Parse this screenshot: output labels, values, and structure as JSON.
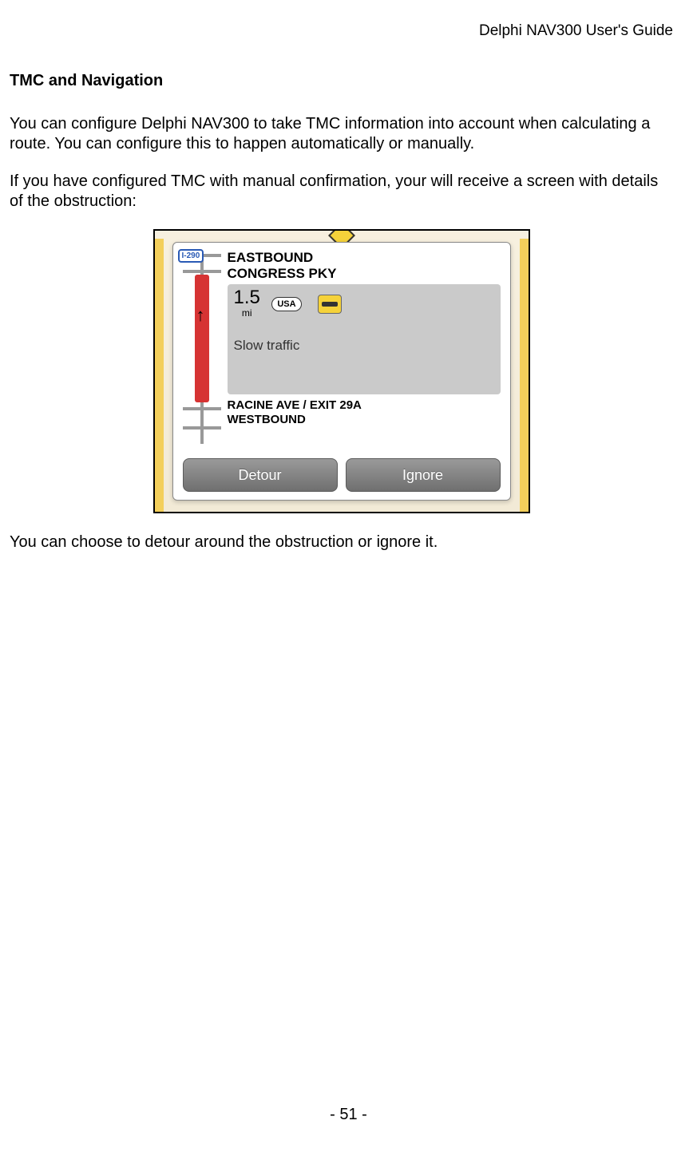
{
  "header": {
    "title": "Delphi NAV300 User's Guide"
  },
  "section": {
    "title": "TMC and Navigation",
    "p1": "You can configure Delphi NAV300 to take TMC information into account when calculating a route.  You can configure this to happen automatically or manually.",
    "p2": "If you have configured TMC with manual confirmation, your will receive a screen with details of the obstruction:",
    "p3": "You can choose to detour around the obstruction or ignore it."
  },
  "tmc": {
    "route_shield": "I-290",
    "direction_top": "EASTBOUND",
    "road_top": "CONGRESS PKY",
    "distance_value": "1.5",
    "distance_unit": "mi",
    "country": "USA",
    "condition": "Slow traffic",
    "exit": "RACINE AVE / EXIT 29A",
    "direction_bottom": "WESTBOUND",
    "detour_label": "Detour",
    "ignore_label": "Ignore"
  },
  "footer": {
    "page": "- 51 -"
  }
}
